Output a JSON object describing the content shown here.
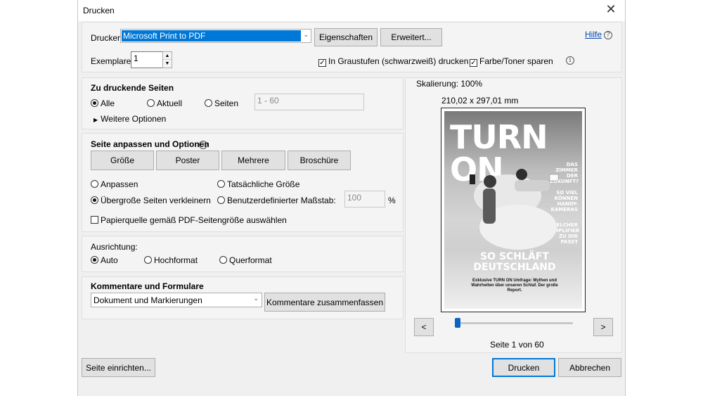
{
  "window": {
    "title": "Drucken",
    "close_glyph": "✕"
  },
  "printer": {
    "label": "Drucker:",
    "selected": "Microsoft Print to PDF",
    "properties_button": "Eigenschaften",
    "advanced_button": "Erweitert...",
    "help_link": "Hilfe",
    "copies_label": "Exemplare:",
    "copies_value": "1",
    "grayscale_label": "In Graustufen (schwarzweiß) drucken",
    "grayscale_checked": true,
    "save_toner_label": "Farbe/Toner sparen",
    "save_toner_checked": true
  },
  "pages": {
    "heading": "Zu druckende Seiten",
    "all": "Alle",
    "current": "Aktuell",
    "pages": "Seiten",
    "range_placeholder": "1 - 60",
    "more_options": "Weitere Optionen",
    "selected": "all"
  },
  "sizing": {
    "heading": "Seite anpassen und Optionen",
    "tabs": [
      "Größe",
      "Poster",
      "Mehrere",
      "Broschüre"
    ],
    "fit": "Anpassen",
    "actual_size": "Tatsächliche Größe",
    "shrink_oversized": "Übergroße Seiten verkleinern",
    "custom_scale": "Benutzerdefinierter Maßstab:",
    "custom_scale_value": "100",
    "percent": "%",
    "selected": "shrink_oversized",
    "paper_source": "Papierquelle gemäß PDF-Seitengröße auswählen",
    "paper_source_checked": false
  },
  "orientation": {
    "heading": "Ausrichtung:",
    "auto": "Auto",
    "portrait": "Hochformat",
    "landscape": "Querformat",
    "selected": "auto"
  },
  "comments": {
    "heading": "Kommentare und Formulare",
    "selected": "Dokument und Markierungen",
    "summarize_button": "Kommentare zusammenfassen"
  },
  "preview": {
    "scaling": "Skalierung: 100%",
    "dimensions": "210,02 x 297,01 mm",
    "prev_button": "<",
    "next_button": ">",
    "page_status": "Seite 1 von 60",
    "page_position": 0.0,
    "cover": {
      "masthead": "TURN ON",
      "blurbs": [
        "DAS ZIMMER DER ZUKUNFT?",
        "SO VIEL KÖNNEN HANDY-KAMERAS",
        "WELCHER AMPLIFIER ZU DIR PASST"
      ],
      "headline": "SO SCHLÄFT DEUTSCHLAND",
      "subline": "Exklusive TURN ON Umfrage: Mythen und Wahrheiten über unseren Schlaf. Der große Report."
    }
  },
  "footer": {
    "page_setup_button": "Seite einrichten...",
    "print_button": "Drucken",
    "cancel_button": "Abbrechen"
  }
}
